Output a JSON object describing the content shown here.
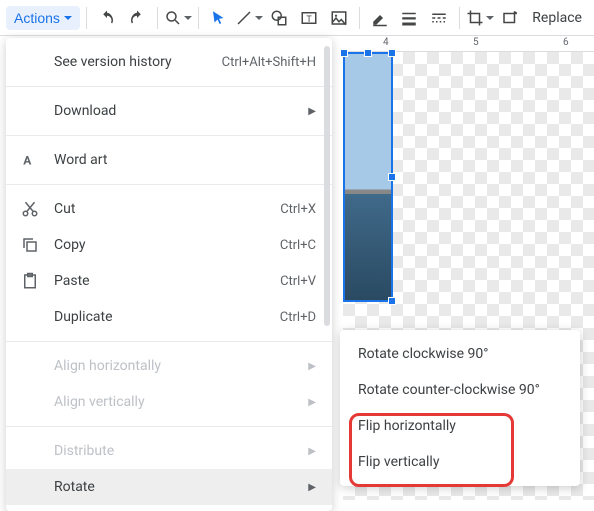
{
  "toolbar": {
    "actions_label": "Actions",
    "replace_label": "Replace"
  },
  "ruler": {
    "marks": [
      "4",
      "5",
      "6"
    ]
  },
  "menu": {
    "version_history": {
      "label": "See version history",
      "shortcut": "Ctrl+Alt+Shift+H"
    },
    "download": {
      "label": "Download"
    },
    "word_art": {
      "label": "Word art"
    },
    "cut": {
      "label": "Cut",
      "shortcut": "Ctrl+X"
    },
    "copy": {
      "label": "Copy",
      "shortcut": "Ctrl+C"
    },
    "paste": {
      "label": "Paste",
      "shortcut": "Ctrl+V"
    },
    "duplicate": {
      "label": "Duplicate",
      "shortcut": "Ctrl+D"
    },
    "align_h": {
      "label": "Align horizontally"
    },
    "align_v": {
      "label": "Align vertically"
    },
    "distribute": {
      "label": "Distribute"
    },
    "rotate": {
      "label": "Rotate"
    }
  },
  "submenu": {
    "rotate_cw": "Rotate clockwise 90°",
    "rotate_ccw": "Rotate counter-clockwise 90°",
    "flip_h": "Flip horizontally",
    "flip_v": "Flip vertically"
  }
}
